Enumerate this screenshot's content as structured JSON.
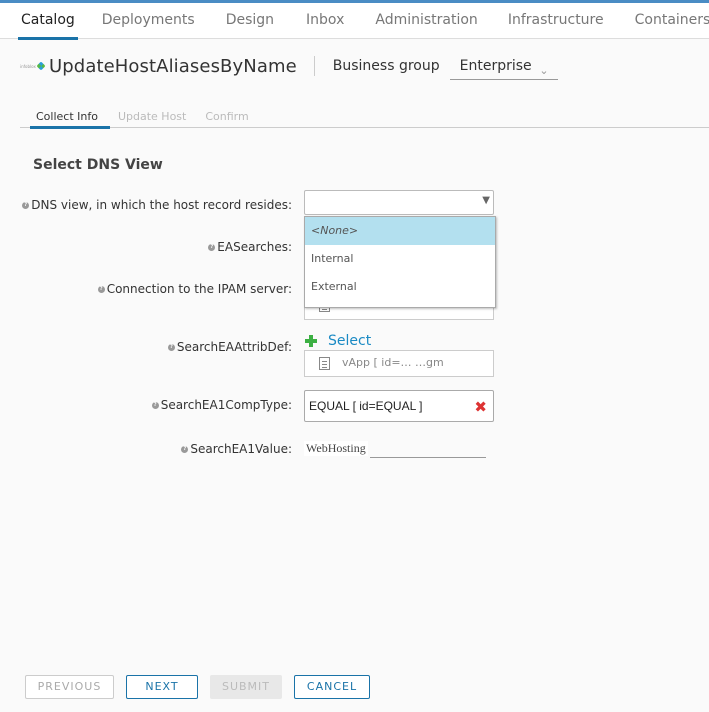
{
  "nav": {
    "items": [
      {
        "label": "Catalog",
        "active": true
      },
      {
        "label": "Deployments"
      },
      {
        "label": "Design"
      },
      {
        "label": "Inbox"
      },
      {
        "label": "Administration"
      },
      {
        "label": "Infrastructure"
      },
      {
        "label": "Containers"
      }
    ]
  },
  "header": {
    "logo_text": "infoblox",
    "title": "UpdateHostAliasesByName",
    "business_group_label": "Business group",
    "business_group_value": "Enterprise"
  },
  "steps": [
    {
      "label": "Collect Info",
      "active": true
    },
    {
      "label": "Update Host"
    },
    {
      "label": "Confirm"
    }
  ],
  "form": {
    "section_title": "Select DNS View",
    "help_glyph": "?",
    "fields": {
      "dns_view": {
        "label": "DNS view, in which the host record resides:",
        "value": ""
      },
      "ea_searches": {
        "label": "EASearches:"
      },
      "ipam_connection": {
        "label": "Connection to the IPAM server:"
      },
      "search_ea_attrib_def": {
        "label": "SearchEAAttribDef:",
        "select_label": "Select",
        "item_text": "vApp [ id=… …gm"
      },
      "search_ea1_comp_type": {
        "label": "SearchEA1CompType:",
        "value": "EQUAL [ id=EQUAL ]",
        "clear_glyph": "✖"
      },
      "search_ea1_value": {
        "label": "SearchEA1Value:",
        "value_label": "WebHosting",
        "input_value": ""
      }
    },
    "dropdown_options": [
      {
        "label": "<None>",
        "highlighted": true
      },
      {
        "label": "Internal"
      },
      {
        "label": "External"
      }
    ]
  },
  "buttons": {
    "previous": "PREVIOUS",
    "next": "NEXT",
    "submit": "SUBMIT",
    "cancel": "CANCEL"
  },
  "colors": {
    "accent": "#1a73a8",
    "top_bar": "#4a8cc4",
    "dropdown_highlight": "#b3e0ef",
    "clear_icon": "#dd3333",
    "add_icon": "#3cb043"
  }
}
